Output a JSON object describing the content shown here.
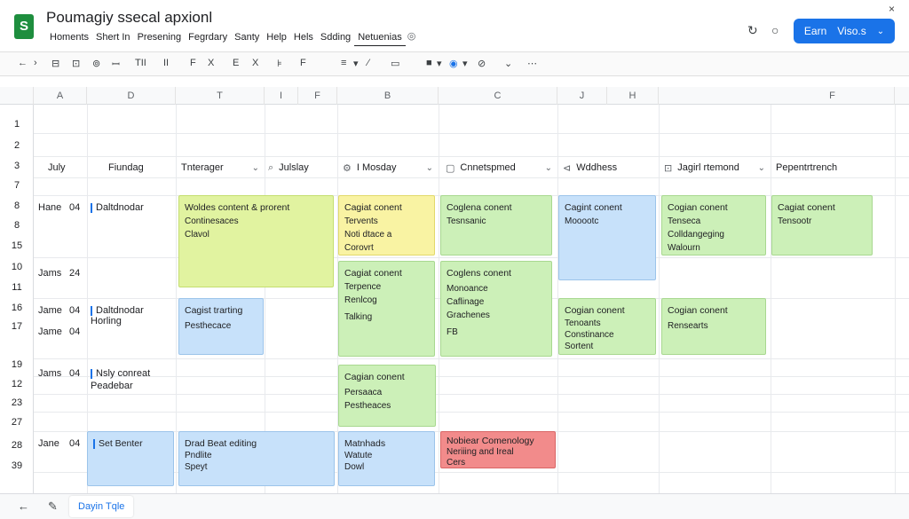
{
  "app": {
    "logo_letter": "S",
    "title": "Poumagiy ssecal apxionl",
    "close_glyph": "×",
    "menu": [
      "Homents",
      "Shert In",
      "Presening",
      "Fegrdary",
      "Santy",
      "Help",
      "Hels",
      "Sdding",
      "Netuenias"
    ],
    "menu_extra_glyph": "◎",
    "header_icons": [
      {
        "name": "history-icon",
        "glyph": "↻"
      },
      {
        "name": "comment-icon",
        "glyph": "○"
      }
    ],
    "share": {
      "label": "Earn",
      "sublabel": "Viso.s",
      "caret": "⌄"
    }
  },
  "toolbar": {
    "items": [
      {
        "name": "undo-icon",
        "glyph": "←"
      },
      {
        "name": "redo-icon",
        "glyph": "›"
      },
      {
        "name": "print-icon",
        "glyph": "⊟"
      },
      {
        "name": "paint-format-icon",
        "glyph": "⊡"
      },
      {
        "name": "zoom-icon",
        "glyph": "⊚"
      },
      {
        "name": "currency-icon",
        "glyph": "ꟷ"
      },
      {
        "name": "text-format-icon",
        "glyph": "TII"
      },
      {
        "name": "pause-icon",
        "glyph": "II"
      },
      {
        "name": "font-icon",
        "glyph": "F"
      },
      {
        "name": "strike-icon",
        "glyph": "X"
      },
      {
        "name": "border-icon",
        "glyph": "E"
      },
      {
        "name": "clear-icon",
        "glyph": "X"
      },
      {
        "name": "align-icon",
        "glyph": "⊧"
      },
      {
        "name": "wrap-icon",
        "glyph": "F"
      },
      {
        "name": "rotate-icon",
        "glyph": "≡"
      },
      {
        "name": "rotate-dropdown",
        "glyph": "▾"
      },
      {
        "name": "link-icon",
        "glyph": "⁄"
      },
      {
        "name": "function-icon",
        "glyph": "▭"
      },
      {
        "name": "chart-icon",
        "glyph": "■"
      },
      {
        "name": "chart-dropdown",
        "glyph": "▾"
      },
      {
        "name": "filter-icon",
        "glyph": "◉"
      },
      {
        "name": "filter-dropdown",
        "glyph": "▾"
      },
      {
        "name": "view-icon",
        "glyph": "⊘"
      },
      {
        "name": "more-dropdown",
        "glyph": "⌄"
      },
      {
        "name": "more-icon",
        "glyph": "⋯"
      }
    ]
  },
  "grid": {
    "columns": [
      "A",
      "D",
      "T",
      "I",
      "F",
      "B",
      "C",
      "J",
      "H",
      "F"
    ],
    "rows": [
      "1",
      "2",
      "3",
      "7",
      "8",
      "8",
      "15",
      "10",
      "11",
      "16",
      "17",
      "19",
      "12",
      "23",
      "27",
      "28",
      "39"
    ],
    "headers": {
      "a": "July",
      "d": "Fiundag",
      "t": "Tnterager",
      "i": "Julslay",
      "b": "I Mosday",
      "c": "Cnnetspmed",
      "j": "Wddhess",
      "h": "Jagirl rtemond",
      "f": "Pepentrtrench"
    },
    "left_entries": [
      {
        "name": "Hane",
        "num": "04",
        "label": "Daltdnodar"
      },
      {
        "name": "Jams",
        "num": "24",
        "label": ""
      },
      {
        "name": "Jame",
        "num": "04",
        "label": "Daltdnodar",
        "sub": "Horling"
      },
      {
        "name": "Jame",
        "num": "04",
        "label": ""
      },
      {
        "name": "Jams",
        "num": "04",
        "label": "Nsly conreat",
        "sub": "Peadebar"
      },
      {
        "name": "Jane",
        "num": "04",
        "label": "Set Benter"
      }
    ],
    "cards": {
      "c1": [
        "Woldes content & prorent",
        "Continesaces",
        "Clavol"
      ],
      "c2": [
        "Cagiat conent",
        "Tervents",
        "Noti dtace a",
        "Corovrt"
      ],
      "c3": [
        "Coglena conent",
        "Tesnsanic"
      ],
      "c4": [
        "Cagint conent",
        "Mooootc"
      ],
      "c5": [
        "Cogian conent",
        "Tenseca",
        "Colldangeging",
        "Walourn"
      ],
      "c6": [
        "Cagiat conent",
        "Tensootr"
      ],
      "c7": [
        "Cagiat conent",
        "Terpence",
        "Renlcog",
        "Talking"
      ],
      "c8": [
        "Coglens conent",
        "Monoance",
        "Caflinage",
        "Grachenes",
        "FB"
      ],
      "c9": [
        "Cagist trarting",
        "Pesthecace"
      ],
      "c10": [
        "Cogian conent",
        "Tenoants",
        "Constinance",
        "Sortent"
      ],
      "c11": [
        "Cogian conent",
        "Rensearts"
      ],
      "c12": [
        "Cagian conent",
        "Persaaca",
        "Pestheaces"
      ],
      "c13": [
        "Drad Beat editing",
        "Pndlite",
        "Speyt"
      ],
      "c14": [
        "Matnhads",
        "Watute",
        "Dowl"
      ],
      "c15": [
        "Nobiear Comenology",
        "Neriiing and Ireal",
        "Cers"
      ]
    }
  },
  "bottom": {
    "icons": [
      {
        "name": "back-arrow-icon",
        "glyph": "←"
      },
      {
        "name": "edit-icon",
        "glyph": "✎"
      }
    ],
    "sheet_tab": "Dayin Tqle"
  }
}
